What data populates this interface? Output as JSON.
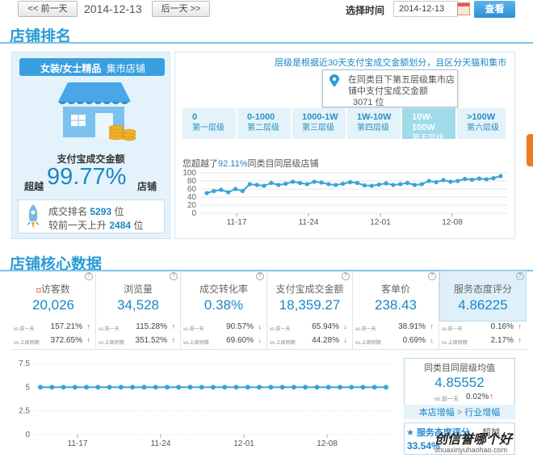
{
  "topbar": {
    "prev": "<< 前一天",
    "date": "2014-12-13",
    "next": "后一天 >>",
    "select_label": "选择时间",
    "date_input": "2014-12-13",
    "query": "查看"
  },
  "rank": {
    "title": "店铺排名",
    "category_name": "女装/女士精品",
    "category_type": "集市店铺",
    "metric_label": "支付宝成交金额",
    "beat_prefix": "超越",
    "beat_value": "99.77%",
    "beat_suffix": "店铺",
    "rank_label": "成交排名",
    "rank_value": "5293",
    "rank_unit": "位",
    "rise_label": "较前一天上升",
    "rise_value": "2484",
    "rise_unit": "位",
    "level_note": "层级是根据近30天支付宝成交金额划分，且区分天猫和集市",
    "tip_line1": "在同类目下第五层级集市店",
    "tip_line2": "铺中支付宝成交金额",
    "tip_rank": "3071 位",
    "levels": [
      {
        "range": "0",
        "name": "第一层级"
      },
      {
        "range": "0-1000",
        "name": "第二层级"
      },
      {
        "range": "1000-1W",
        "name": "第三层级"
      },
      {
        "range": "1W-10W",
        "name": "第四层级"
      },
      {
        "range": "10W-100W",
        "name": "第五层级"
      },
      {
        "range": ">100W",
        "name": "第六层级"
      }
    ],
    "trend_prefix": "您超越了",
    "trend_value": "92.11%",
    "trend_suffix": "同类目同层级店铺"
  },
  "rank_chart": {
    "chart_data": {
      "type": "line",
      "x_ticks": [
        "11-17",
        "11-24",
        "12-01",
        "12-08"
      ],
      "yticks": [
        0,
        20,
        40,
        60,
        80,
        100
      ],
      "ylim": [
        0,
        100
      ],
      "series": [
        {
          "values": [
            50,
            55,
            58,
            52,
            60,
            55,
            72,
            70,
            68,
            75,
            70,
            73,
            78,
            75,
            72,
            78,
            76,
            72,
            70,
            73,
            77,
            75,
            69,
            68,
            71,
            74,
            70,
            72,
            75,
            70,
            72,
            80,
            77,
            82,
            78,
            80,
            85,
            83,
            86,
            84,
            87,
            92
          ]
        }
      ]
    }
  },
  "core": {
    "title": "店铺核心数据",
    "cards": [
      {
        "label": "访客数",
        "value": "20,026",
        "day": "157.21%",
        "day_dir": "↑",
        "week": "372.65%",
        "week_dir": "↑"
      },
      {
        "label": "浏览量",
        "value": "34,528",
        "day": "115.28%",
        "day_dir": "↑",
        "week": "351.52%",
        "week_dir": "↑"
      },
      {
        "label": "成交转化率",
        "value": "0.38%",
        "day": "90.57%",
        "day_dir": "↓",
        "week": "69.60%",
        "week_dir": "↓"
      },
      {
        "label": "支付宝成交金额",
        "value": "18,359.27",
        "day": "65.94%",
        "day_dir": "↓",
        "week": "44.28%",
        "week_dir": "↓"
      },
      {
        "label": "客单价",
        "value": "238.43",
        "day": "38.91%",
        "day_dir": "↑",
        "week": "0.69%",
        "week_dir": "↓"
      },
      {
        "label": "服务态度评分",
        "value": "4.86225",
        "day": "0.16%",
        "day_dir": "↑",
        "week": "2.17%",
        "week_dir": "↑"
      }
    ],
    "cmp_day": "vs.前一天",
    "cmp_week": "vs.上周同期",
    "avg_label": "同类目同层级均值",
    "avg_value": "4.85552",
    "avg_cmp": "vs.前一天",
    "avg_change": "0.02%",
    "avg_link1": "本店增幅",
    "avg_sep": ">",
    "avg_link2": "行业增幅",
    "service_label": "服务态度评分",
    "service_rest": "超越",
    "service_pct": "33.54%",
    "watermark": "创信誉哪个好",
    "watermark_sub": "shuaxinyuhaohao.com"
  },
  "core_chart": {
    "chart_data": {
      "type": "line",
      "x_ticks": [
        "11-17",
        "11-24",
        "12-01",
        "12-08"
      ],
      "yticks": [
        0,
        2.5,
        5,
        7.5
      ],
      "ylim": [
        0,
        7.5
      ],
      "series": [
        {
          "values": [
            5,
            5,
            5,
            5,
            5,
            5,
            5,
            5,
            5,
            5,
            5,
            5,
            5,
            5,
            5,
            5,
            5,
            5,
            5,
            5,
            5,
            5,
            5,
            5,
            5,
            5,
            5,
            5,
            5,
            5,
            5
          ]
        }
      ]
    }
  }
}
